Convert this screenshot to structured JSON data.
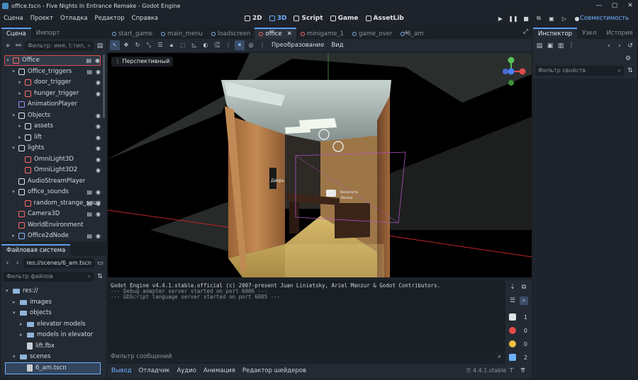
{
  "titlebar": {
    "title": "office.tscn - Five Nights In Entrance Remake - Godot Engine"
  },
  "menu": [
    "Сцена",
    "Проект",
    "Отладка",
    "Редактор",
    "Справка"
  ],
  "modes": [
    "2D",
    "3D",
    "Script",
    "Game",
    "AssetLib"
  ],
  "renderer": "Совместимость",
  "scene_panel": {
    "tabs": [
      "Сцена",
      "Импорт"
    ],
    "filter_placeholder": "Фильтр: имя, t:тип,",
    "tree": [
      {
        "label": "Office",
        "depth": 0,
        "arrow": "v",
        "color": "#ff6b6b",
        "script": true,
        "eye": true
      },
      {
        "label": "Office_triggers",
        "depth": 1,
        "arrow": "v",
        "color": "#e4e7ea",
        "script": true,
        "eye": true
      },
      {
        "label": "door_trigger",
        "depth": 2,
        "arrow": ">",
        "color": "#ff6b6b",
        "script": false,
        "eye": true
      },
      {
        "label": "hunger_trigger",
        "depth": 2,
        "arrow": ">",
        "color": "#ff6b6b",
        "script": false,
        "eye": true
      },
      {
        "label": "AnimationPlayer",
        "depth": 1,
        "arrow": "",
        "color": "#a98bff",
        "script": false,
        "eye": false
      },
      {
        "label": "Objects",
        "depth": 1,
        "arrow": "v",
        "color": "#e4e7ea",
        "script": false,
        "eye": true
      },
      {
        "label": "assets",
        "depth": 2,
        "arrow": ">",
        "color": "#e4e7ea",
        "script": false,
        "eye": true
      },
      {
        "label": "lift",
        "depth": 2,
        "arrow": ">",
        "color": "#e4e7ea",
        "script": false,
        "eye": true
      },
      {
        "label": "lights",
        "depth": 1,
        "arrow": "v",
        "color": "#e4e7ea",
        "script": false,
        "eye": true
      },
      {
        "label": "OmniLight3D",
        "depth": 2,
        "arrow": "",
        "color": "#ff6b6b",
        "script": false,
        "eye": true
      },
      {
        "label": "OmniLight3D2",
        "depth": 2,
        "arrow": "",
        "color": "#ff6b6b",
        "script": false,
        "eye": true
      },
      {
        "label": "AudioStreamPlayer",
        "depth": 1,
        "arrow": "",
        "color": "#e4e7ea",
        "script": false,
        "eye": false
      },
      {
        "label": "office_sounds",
        "depth": 1,
        "arrow": "v",
        "color": "#e4e7ea",
        "script": true,
        "eye": true
      },
      {
        "label": "random_strange_soun",
        "depth": 2,
        "arrow": "",
        "color": "#ff6b6b",
        "script": true,
        "eye": true
      },
      {
        "label": "Camera3D",
        "depth": 1,
        "arrow": "",
        "color": "#ff6b6b",
        "script": true,
        "eye": true
      },
      {
        "label": "WorldEnvironment",
        "depth": 1,
        "arrow": "",
        "color": "#ff6b6b",
        "script": false,
        "eye": false
      },
      {
        "label": "Office2dNode",
        "depth": 1,
        "arrow": ">",
        "color": "#8fb4ff",
        "script": true,
        "eye": true
      }
    ]
  },
  "filesystem": {
    "title": "Файловая система",
    "path": "res://scenes/6_am.tscn",
    "filter_placeholder": "Фильтр файлов",
    "items": [
      {
        "label": "res://",
        "depth": 0,
        "kind": "folder",
        "arrow": "v"
      },
      {
        "label": "images",
        "depth": 1,
        "kind": "folder",
        "arrow": ">"
      },
      {
        "label": "objects",
        "depth": 1,
        "kind": "folder",
        "arrow": "v"
      },
      {
        "label": "elevator models",
        "depth": 2,
        "kind": "folder",
        "arrow": ">"
      },
      {
        "label": "models in elevator",
        "depth": 2,
        "kind": "folder",
        "arrow": ">"
      },
      {
        "label": "lift.fbx",
        "depth": 2,
        "kind": "file",
        "arrow": ""
      },
      {
        "label": "scenes",
        "depth": 1,
        "kind": "folder",
        "arrow": "v"
      },
      {
        "label": "6_am.tscn",
        "depth": 2,
        "kind": "file",
        "arrow": "",
        "selected": true
      }
    ]
  },
  "scene_tabs": [
    {
      "label": "start_game",
      "active": false
    },
    {
      "label": "main_menu",
      "active": false
    },
    {
      "label": "loadscreen",
      "active": false
    },
    {
      "label": "office",
      "active": true
    },
    {
      "label": "minigame_1",
      "active": false
    },
    {
      "label": "game_over",
      "active": false
    },
    {
      "label": "6_am",
      "active": false
    }
  ],
  "viewport_toolbar": {
    "transform": "Преобразование",
    "view": "Вид"
  },
  "viewport": {
    "perspective": "Перспективный",
    "sign_left": "Дверь",
    "sign_center_1": "Бежнуть",
    "sign_center_2": "Лезка"
  },
  "output": {
    "lines": [
      "Godot Engine v4.4.1.stable.official (c) 2007-present Juan Linietsky, Ariel Manzur & Godot Contributors.",
      "--- Debug adapter server started on port 6006 ---",
      "--- GDScript language server started on port 6005 ---"
    ],
    "filter_placeholder": "Фильтр сообщений",
    "counts": {
      "messages": "1",
      "errors": "0",
      "warnings": "0",
      "info": "2"
    }
  },
  "bottom_tabs": [
    "Вывод",
    "Отладчик",
    "Аудио",
    "Анимация",
    "Редактор шейдеров"
  ],
  "version": "4.4.1.stable",
  "inspector": {
    "tabs": [
      "Инспектор",
      "Узел",
      "История"
    ],
    "filter_placeholder": "Фильтр свойств"
  }
}
